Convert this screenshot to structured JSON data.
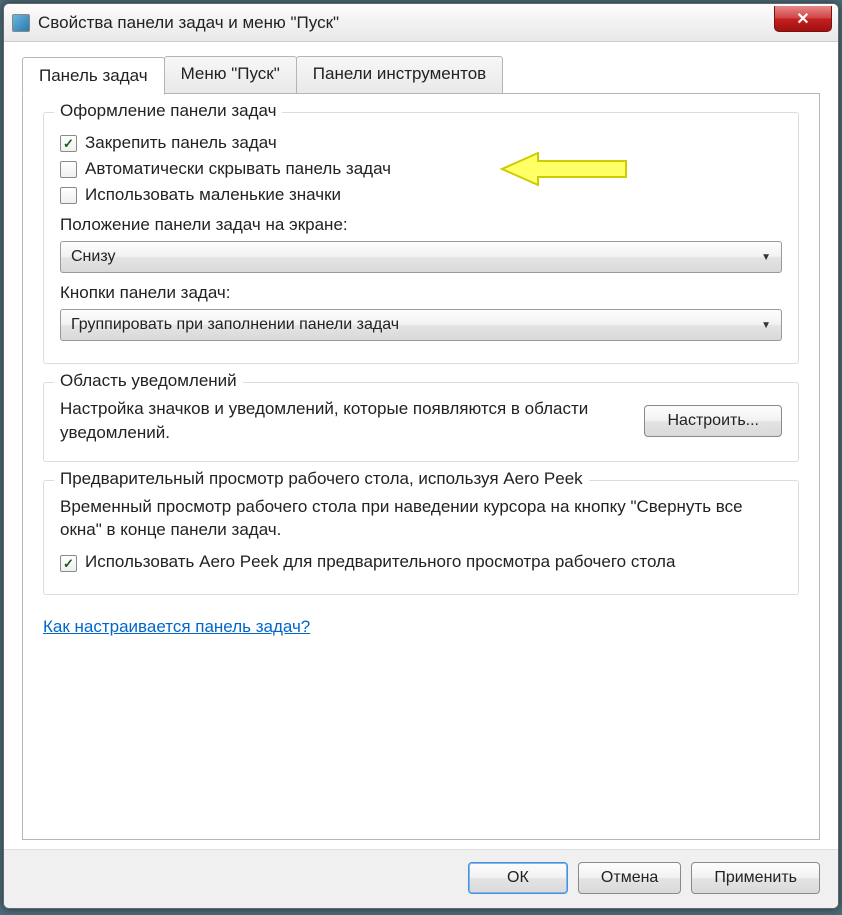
{
  "window": {
    "title": "Свойства панели задач и меню \"Пуск\""
  },
  "tabs": {
    "taskbar": "Панель задач",
    "startmenu": "Меню \"Пуск\"",
    "toolbars": "Панели инструментов"
  },
  "appearance": {
    "legend": "Оформление панели задач",
    "lock_label": "Закрепить панель задач",
    "lock_checked": true,
    "autohide_label": "Автоматически скрывать панель задач",
    "autohide_checked": false,
    "smallicons_label": "Использовать маленькие значки",
    "smallicons_checked": false,
    "position_label": "Положение панели задач на экране:",
    "position_value": "Снизу",
    "buttons_label": "Кнопки панели задач:",
    "buttons_value": "Группировать при заполнении панели задач"
  },
  "notifications": {
    "legend": "Область уведомлений",
    "text": "Настройка значков и уведомлений, которые появляются в области уведомлений.",
    "customize_btn": "Настроить..."
  },
  "aeropeek": {
    "legend": "Предварительный просмотр рабочего стола, используя Aero Peek",
    "text": "Временный просмотр рабочего стола при наведении курсора на кнопку \"Свернуть все окна\" в конце панели задач.",
    "checkbox_label": "Использовать Aero Peek для предварительного просмотра рабочего стола",
    "checked": true
  },
  "help_link": "Как настраивается панель задач?",
  "buttons": {
    "ok": "ОК",
    "cancel": "Отмена",
    "apply": "Применить"
  }
}
